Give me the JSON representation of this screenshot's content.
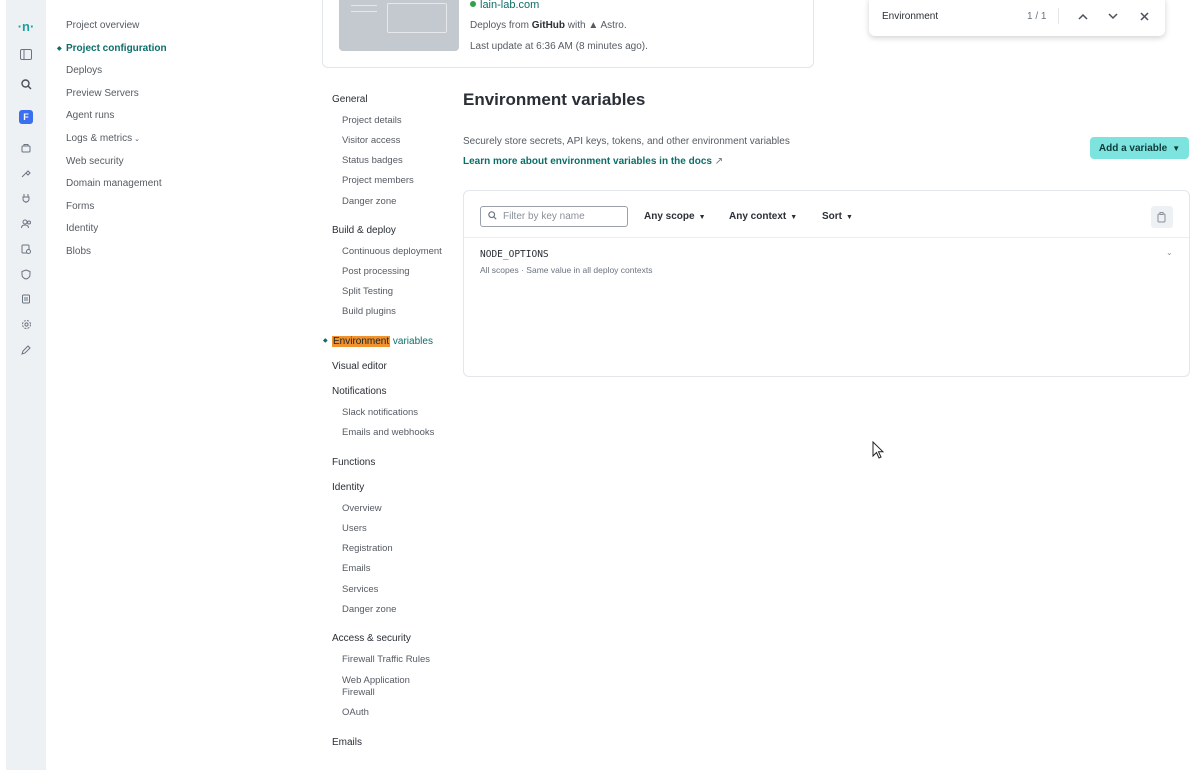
{
  "rail": {
    "team_letter": "F"
  },
  "project_nav": [
    {
      "label": "Project overview",
      "active": false
    },
    {
      "label": "Project configuration",
      "active": true
    },
    {
      "label": "Deploys",
      "active": false
    },
    {
      "label": "Preview Servers",
      "active": false
    },
    {
      "label": "Agent runs",
      "active": false
    },
    {
      "label": "Logs & metrics",
      "active": false,
      "has_chevron": true
    },
    {
      "label": "Web security",
      "active": false
    },
    {
      "label": "Domain management",
      "active": false
    },
    {
      "label": "Forms",
      "active": false
    },
    {
      "label": "Identity",
      "active": false
    },
    {
      "label": "Blobs",
      "active": false
    }
  ],
  "site": {
    "domain": "lain-lab.com",
    "deploy_prefix": "Deploys from",
    "deploy_source": "GitHub",
    "deploy_with": "with",
    "framework": "Astro.",
    "last_update": "Last update at 6:36 AM (8 minutes ago)."
  },
  "find": {
    "query": "Environment",
    "count": "1 / 1"
  },
  "settings_nav": {
    "general": "General",
    "general_items": [
      "Project details",
      "Visitor access",
      "Status badges",
      "Project members",
      "Danger zone"
    ],
    "build": "Build & deploy",
    "build_items": [
      "Continuous deployment",
      "Post processing",
      "Split Testing",
      "Build plugins"
    ],
    "env_highlight": "Environment",
    "env_rest": " variables",
    "visual_editor": "Visual editor",
    "notifications": "Notifications",
    "notification_items": [
      "Slack notifications",
      "Emails and webhooks"
    ],
    "functions": "Functions",
    "identity": "Identity",
    "identity_items": [
      "Overview",
      "Users",
      "Registration",
      "Emails",
      "Services",
      "Danger zone"
    ],
    "access": "Access & security",
    "access_items": [
      "Firewall Traffic Rules",
      "Web Application Firewall",
      "OAuth"
    ],
    "emails": "Emails"
  },
  "main": {
    "title": "Environment variables",
    "description": "Securely store secrets, API keys, tokens, and other environment variables",
    "docs_link": "Learn more about environment variables in the docs",
    "add_button": "Add a variable",
    "filter_placeholder": "Filter by key name",
    "scope_filter": "Any scope",
    "context_filter": "Any context",
    "sort": "Sort",
    "variables": [
      {
        "name": "NODE_OPTIONS",
        "meta": "All scopes · Same value in all deploy contexts"
      }
    ]
  },
  "colors": {
    "accent": "#0b6e69",
    "add_button_bg": "#7de3df",
    "find_highlight": "#f0922d"
  }
}
